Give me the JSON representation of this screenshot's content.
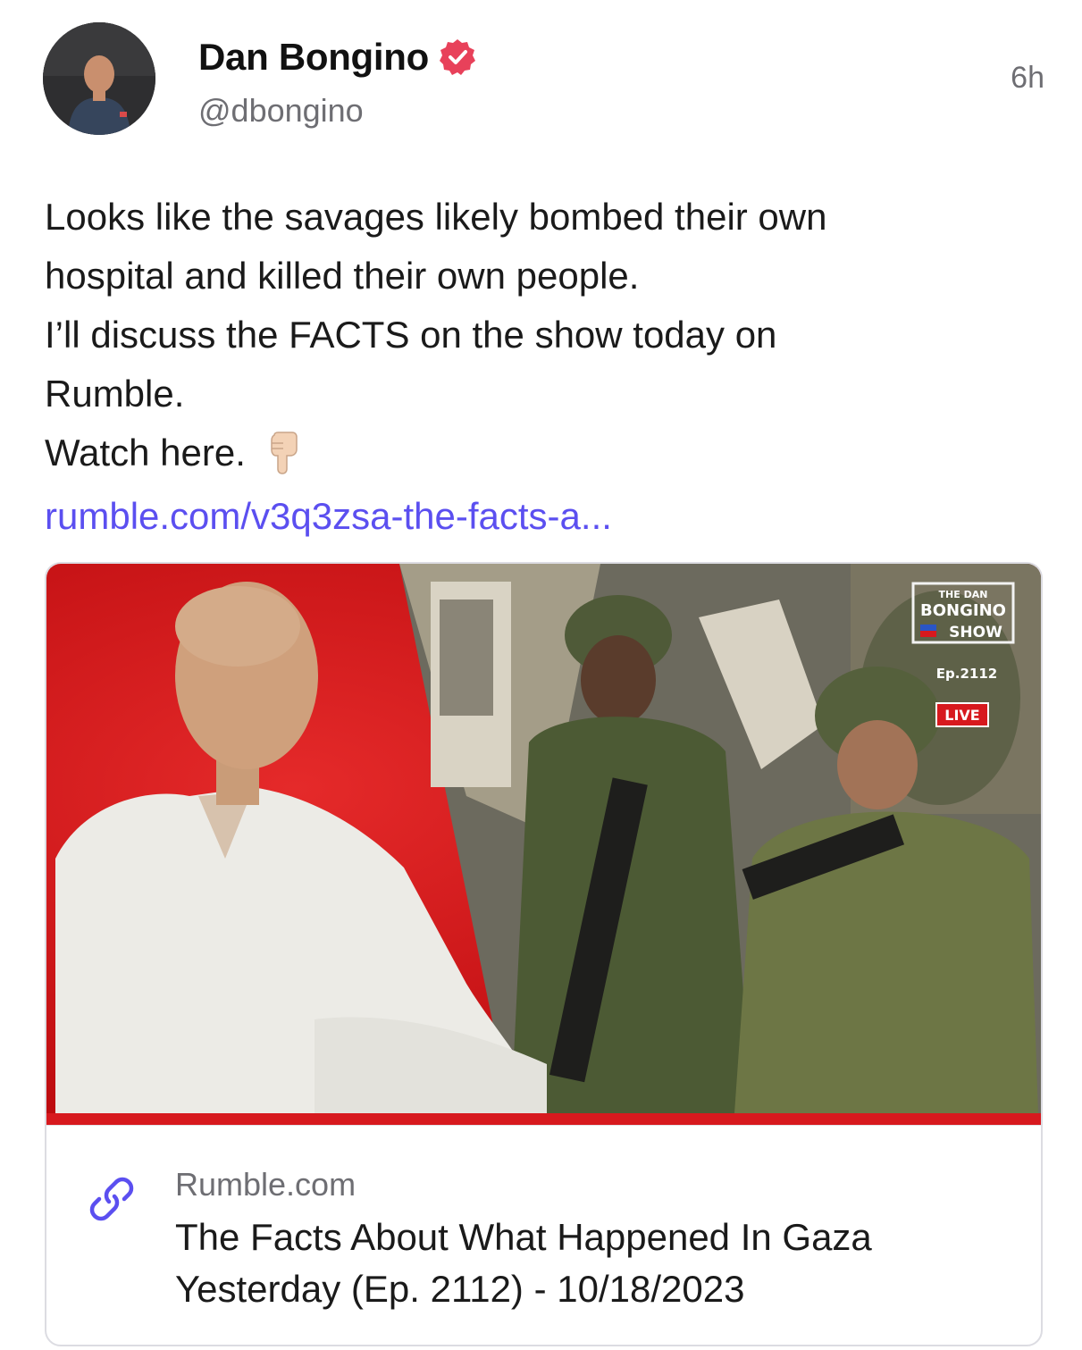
{
  "author": {
    "name": "Dan Bongino",
    "handle": "@dbongino",
    "verified_icon": "verified-badge-icon",
    "avatar": "avatar"
  },
  "timestamp": "6h",
  "post": {
    "lines": [
      "Looks like the savages likely bombed their own",
      "hospital and killed their own people.",
      "I’ll discuss the FACTS on the show today on",
      "Rumble.",
      "Watch here."
    ],
    "emoji": "pointing-down-icon",
    "link_text": "rumble.com/v3q3zsa-the-facts-a..."
  },
  "card": {
    "domain": "Rumble.com",
    "title_line1": "The Facts About What Happened In Gaza",
    "title_line2": "Yesterday (Ep. 2112) - 10/18/2023",
    "thumbnail_badge": {
      "line1": "THE DAN",
      "line2": "BONGINO",
      "line3": "SHOW",
      "episode": "Ep.2112",
      "live": "LIVE"
    }
  },
  "colors": {
    "verified": "#e8415a",
    "link": "#5b4ff0",
    "thumb_red": "#d7191e",
    "secondary_text": "#6e6e73"
  }
}
